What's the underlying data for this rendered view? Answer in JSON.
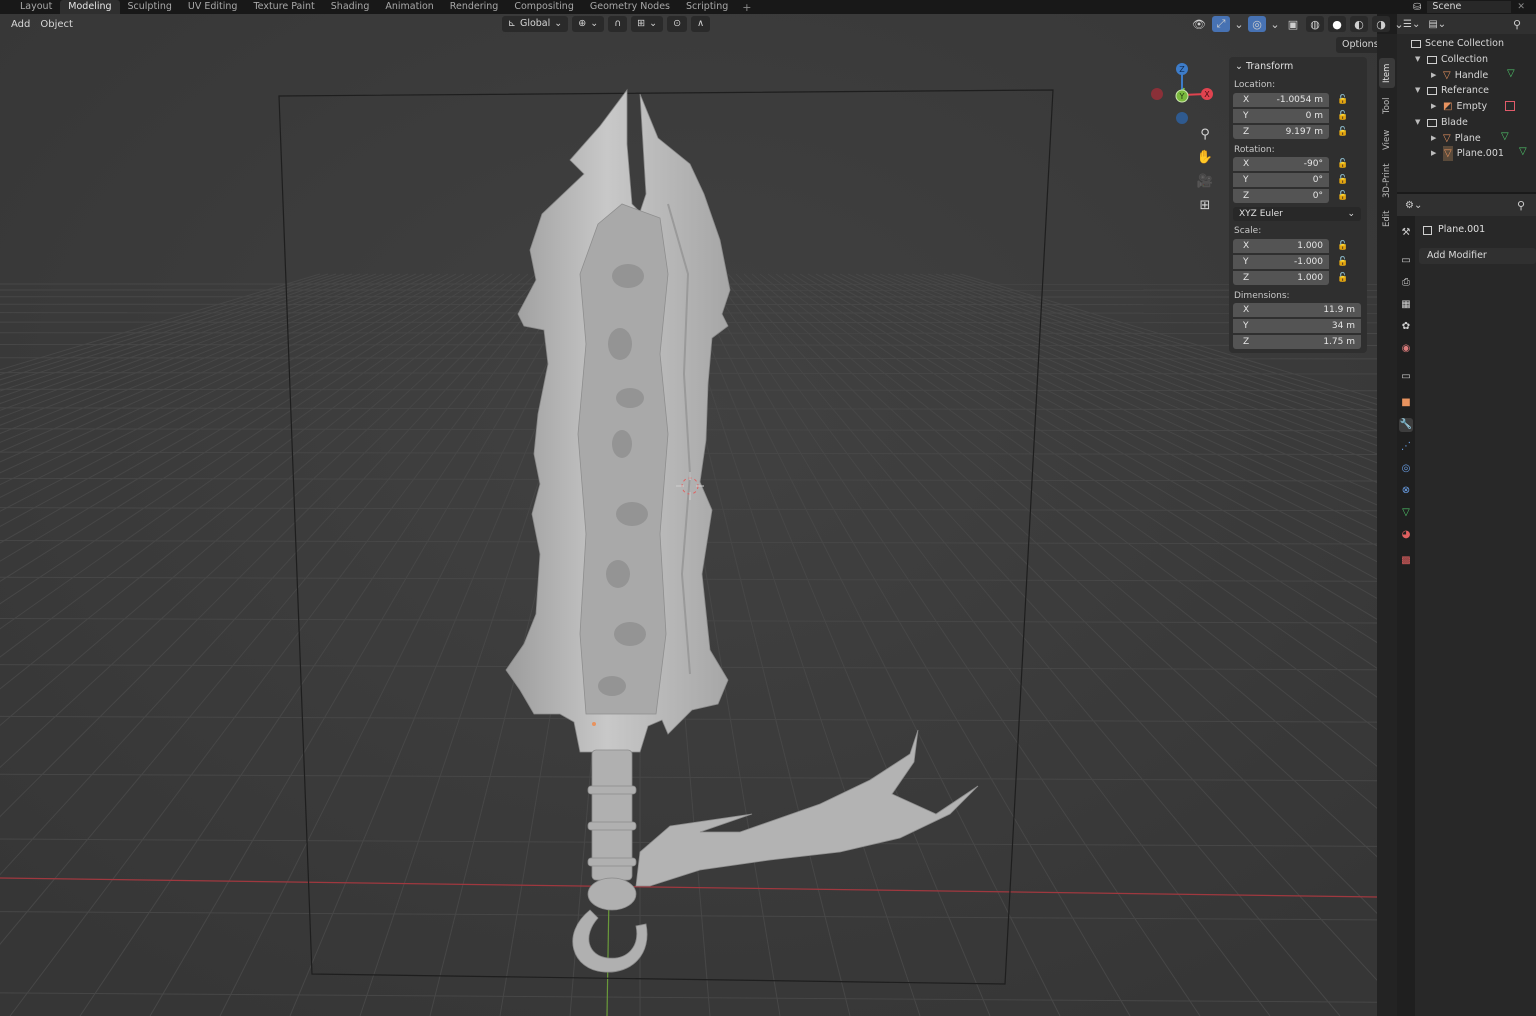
{
  "workspaces": [
    "Layout",
    "Modeling",
    "Sculpting",
    "UV Editing",
    "Texture Paint",
    "Shading",
    "Animation",
    "Rendering",
    "Compositing",
    "Geometry Nodes",
    "Scripting"
  ],
  "active_workspace": "Modeling",
  "scene_name": "Scene",
  "viewport_menu": {
    "add": "Add",
    "object": "Object"
  },
  "transform_orientation": "Global",
  "options_label": "Options",
  "npanel": {
    "title": "Transform",
    "location_label": "Location:",
    "location": {
      "x": "-1.0054 m",
      "y": "0 m",
      "z": "9.197 m"
    },
    "rotation_label": "Rotation:",
    "rotation": {
      "x": "-90°",
      "y": "0°",
      "z": "0°"
    },
    "rotation_mode": "XYZ Euler",
    "scale_label": "Scale:",
    "scale": {
      "x": "1.000",
      "y": "-1.000",
      "z": "1.000"
    },
    "dimensions_label": "Dimensions:",
    "dimensions": {
      "x": "11.9 m",
      "y": "34 m",
      "z": "1.75 m"
    },
    "axis_x": "X",
    "axis_y": "Y",
    "axis_z": "Z"
  },
  "side_tabs": [
    "Item",
    "Tool",
    "View",
    "3D-Print",
    "Edit"
  ],
  "gizmo": {
    "x": "X",
    "y": "Y",
    "z": "Z"
  },
  "outliner": {
    "scene_collection": "Scene Collection",
    "collection": "Collection",
    "handle": "Handle",
    "referance": "Referance",
    "empty": "Empty",
    "blade": "Blade",
    "plane": "Plane",
    "plane001": "Plane.001"
  },
  "properties": {
    "object_name": "Plane.001",
    "add_modifier": "Add Modifier"
  },
  "colors": {
    "accent_blue": "#4772b3",
    "axis_red": "#e0434f",
    "axis_green": "#7ab83d",
    "axis_blue": "#3d7cc9",
    "mesh_grey": "#b8b8b8",
    "object_orange": "#e8935f",
    "mesh_data_green": "#4fc86b"
  }
}
